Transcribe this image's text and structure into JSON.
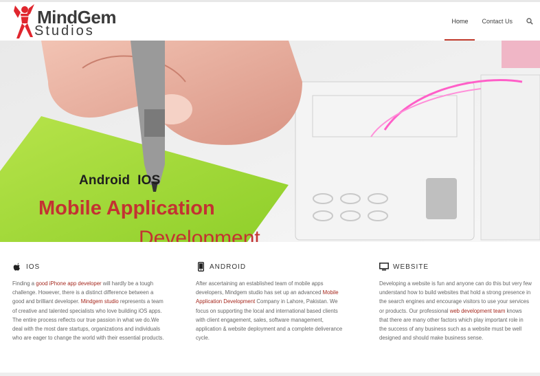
{
  "brand": {
    "name_line1": "MindGem",
    "name_line2": "Studios",
    "accent": "#e0262e"
  },
  "nav": {
    "items": [
      {
        "label": "Home",
        "active": true
      },
      {
        "label": "Contact Us",
        "active": false
      }
    ],
    "search_icon": "search-icon"
  },
  "hero": {
    "line1": "Android  IOS",
    "line2": "Mobile Application",
    "line3": "Development",
    "accent_color": "#c33232"
  },
  "services": [
    {
      "icon": "apple-icon",
      "title": "IOS",
      "text": [
        {
          "t": "Finding a "
        },
        {
          "t": "good iPhone app developer",
          "hl": true
        },
        {
          "t": " will hardly be a tough challenge. However, there is a distinct difference between a good and brilliant developer. "
        },
        {
          "t": "Mindgem studio",
          "hl": true
        },
        {
          "t": " represents a team of creative and talented specialists who love building iOS apps. The entire process reflects our true passion in what we do.We deal with the most dare startups, organizations and individuals who are eager to change the world with their essential products."
        }
      ]
    },
    {
      "icon": "mobile-phone-icon",
      "title": "ANDROID",
      "text": [
        {
          "t": "After ascertaining an established team of mobile apps developers, Mindgem studio has set up an advanced "
        },
        {
          "t": "Mobile Application Development",
          "hl": true
        },
        {
          "t": " Company in Lahore, Pakistan. We focus on supporting the local and international based clients with client engagement, sales, software management, application & website deployment and a complete deliverance cycle."
        }
      ]
    },
    {
      "icon": "monitor-icon",
      "title": "WEBSITE",
      "text": [
        {
          "t": "Developing a website is fun and anyone can do this but very few understand how to build websites that hold a strong presence in the search engines and encourage visitors to use your services or products. Our professional "
        },
        {
          "t": "web development team",
          "hl": true
        },
        {
          "t": " knows that there are many other factors which play important role in the success of any business such as a website must be well designed and should make business sense."
        }
      ]
    }
  ]
}
